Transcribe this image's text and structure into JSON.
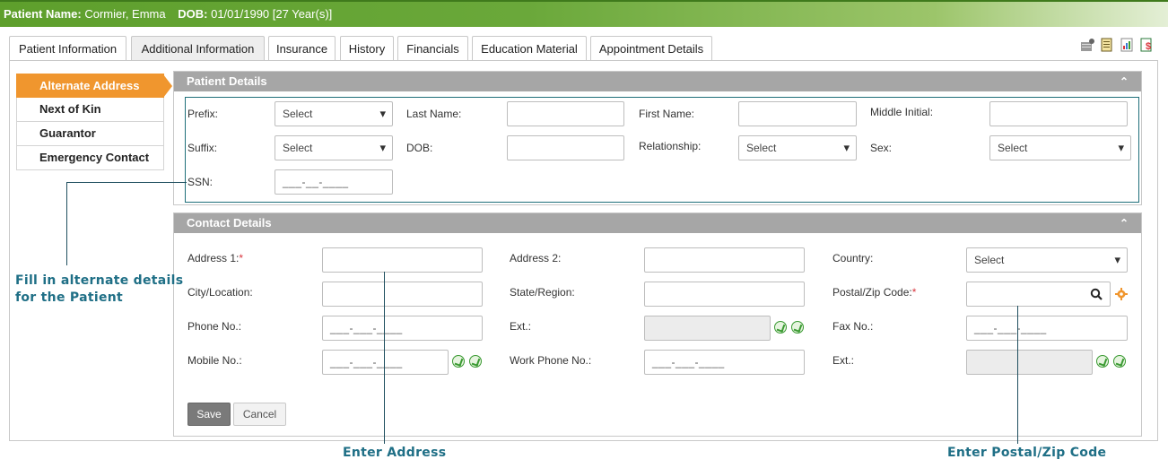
{
  "header": {
    "patient_name_label": "Patient Name:",
    "patient_name": "Cormier, Emma",
    "dob_label": "DOB:",
    "dob": "01/01/1990 [27 Year(s)]"
  },
  "tabs": [
    {
      "label": "Patient Information"
    },
    {
      "label": "Additional Information"
    },
    {
      "label": "Insurance"
    },
    {
      "label": "History"
    },
    {
      "label": "Financials"
    },
    {
      "label": "Education Material"
    },
    {
      "label": "Appointment Details"
    }
  ],
  "sidebar": {
    "items": [
      {
        "label": "Alternate Address"
      },
      {
        "label": "Next of Kin"
      },
      {
        "label": "Guarantor"
      },
      {
        "label": "Emergency Contact"
      }
    ]
  },
  "patient_details": {
    "title": "Patient Details",
    "prefix_label": "Prefix:",
    "prefix_value": "Select",
    "last_name_label": "Last Name:",
    "first_name_label": "First Name:",
    "middle_initial_label": "Middle Initial:",
    "suffix_label": "Suffix:",
    "suffix_value": "Select",
    "dob_label": "DOB:",
    "relationship_label": "Relationship:",
    "relationship_value": "Select",
    "sex_label": "Sex:",
    "sex_value": "Select",
    "ssn_label": "SSN:",
    "ssn_placeholder": "___-__-____"
  },
  "contact_details": {
    "title": "Contact Details",
    "address1_label": "Address 1:",
    "address1_required": "*",
    "address2_label": "Address 2:",
    "country_label": "Country:",
    "country_value": "Select",
    "city_label": "City/Location:",
    "state_label": "State/Region:",
    "postal_label": "Postal/Zip Code:",
    "postal_required": "*",
    "phone_label": "Phone No.:",
    "phone_placeholder": "___-___-____",
    "ext_label": "Ext.:",
    "fax_label": "Fax No.:",
    "fax_placeholder": "___-___-____",
    "mobile_label": "Mobile No.:",
    "mobile_placeholder": "___-___-____",
    "work_phone_label": "Work Phone No.:",
    "work_phone_placeholder": "___-___-____",
    "ext2_label": "Ext.:"
  },
  "buttons": {
    "save": "Save",
    "cancel": "Cancel"
  },
  "annotations": {
    "alternate_details": "Fill in alternate details\nfor the Patient",
    "enter_address": "Enter Address",
    "enter_postal": "Enter Postal/Zip Code"
  },
  "colors": {
    "header_green": "#6aa83a",
    "active_orange": "#f0962e",
    "panel_grey": "#a6a6a6",
    "annotation_teal": "#1f6f86"
  }
}
